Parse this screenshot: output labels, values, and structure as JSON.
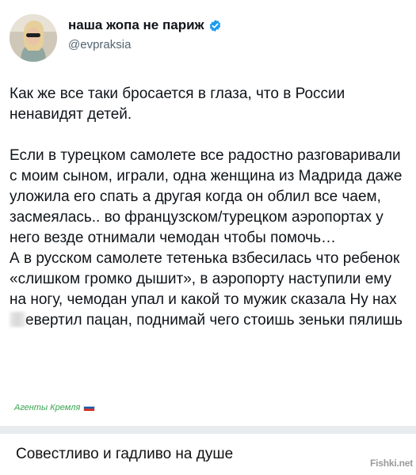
{
  "tweet": {
    "display_name": "наша жопа не париж",
    "handle": "@evpraksia",
    "verified": true,
    "avatar_icon": "avatar-photo",
    "paragraphs": [
      "Как же все таки бросается в глаза, что в России ненавидят детей.",
      "Если в турецком самолете все радостно разговаривали с моим сыном, играли, одна женщина из Мадрида даже уложила его спать а другая когда он облил все чаем, засмеялась.. во французском/турецком аэропортах у него везде отнимали чемодан чтобы помочь…",
      "А в русском самолете тетенька взбесилась что ребенок «слишком громко дышит», в аэропорту наступили ему на ногу, чемодан упал и какой то мужик сказала Ну нах"
    ],
    "paragraph3_after_censor": "евертил пацан, поднимай чего стоишь зеньки пялишь"
  },
  "watermark": {
    "text": "Агенты Кремля",
    "flag_icon": "russia-flag-icon"
  },
  "caption": "Совестливо и гадливо на душе",
  "site_logo": "Fishki.net",
  "colors": {
    "verified": "#1d9bf0",
    "handle": "#536471",
    "watermark": "#37a651",
    "separator": "#e9ecef"
  }
}
